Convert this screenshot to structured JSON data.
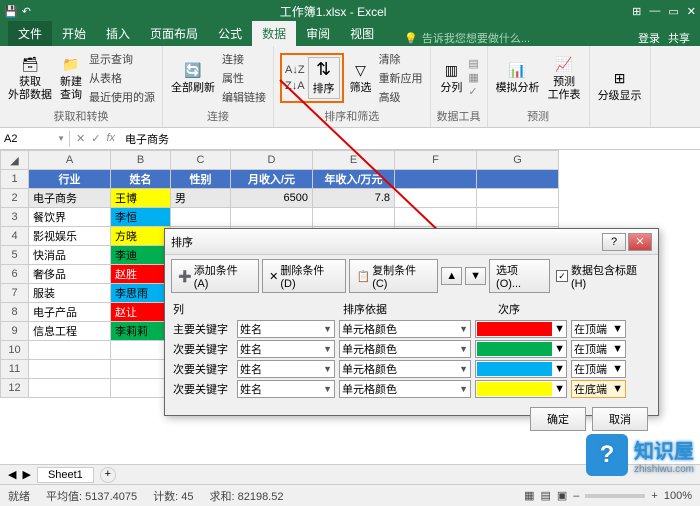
{
  "title": "工作簿1.xlsx - Excel",
  "tabs": {
    "file": "文件",
    "home": "开始",
    "insert": "插入",
    "layout": "页面布局",
    "formula": "公式",
    "data": "数据",
    "review": "审阅",
    "view": "视图",
    "tell": "告诉我您想要做什么...",
    "login": "登录",
    "share": "共享"
  },
  "ribbon": {
    "g1": {
      "btn1": "获取\n外部数据",
      "btn2": "新建\n查询",
      "s1": "显示查询",
      "s2": "从表格",
      "s3": "最近使用的源",
      "label": "获取和转换"
    },
    "g2": {
      "btn": "全部刷新",
      "s1": "连接",
      "s2": "属性",
      "s3": "编辑链接",
      "label": "连接"
    },
    "g3": {
      "az": "A↓Z",
      "za": "Z↓A",
      "sort": "排序",
      "filter": "筛选",
      "clear": "清除",
      "reapply": "重新应用",
      "adv": "高级",
      "label": "排序和筛选"
    },
    "g4": {
      "btn": "分列",
      "label": "数据工具"
    },
    "g5": {
      "b1": "模拟分析",
      "b2": "预测\n工作表",
      "label": "预测"
    },
    "g6": {
      "btn": "分级显示",
      "label": ""
    }
  },
  "namebox": "A2",
  "formula": "电子商务",
  "cols": [
    "A",
    "B",
    "C",
    "D",
    "E",
    "F",
    "G"
  ],
  "headers": [
    "行业",
    "姓名",
    "性别",
    "月收入/元",
    "年收入/万元"
  ],
  "rows": [
    {
      "r": 2,
      "a": "电子商务",
      "b": "王博",
      "bcolor": "#ffff00",
      "c": "男",
      "d": "6500",
      "e": "7.8",
      "sel": true
    },
    {
      "r": 3,
      "a": "餐饮界",
      "b": "李恒",
      "bcolor": "#00b0f0"
    },
    {
      "r": 4,
      "a": "影视娱乐",
      "b": "方晓",
      "bcolor": "#ffff00"
    },
    {
      "r": 5,
      "a": "快消品",
      "b": "李迪",
      "bcolor": "#00b050"
    },
    {
      "r": 6,
      "a": "奢侈品",
      "b": "赵胜",
      "bcolor": "#ff0000",
      "fg": "#fff"
    },
    {
      "r": 7,
      "a": "服装",
      "b": "李思雨",
      "bcolor": "#00b0f0"
    },
    {
      "r": 8,
      "a": "电子产品",
      "b": "赵让",
      "bcolor": "#ff0000",
      "fg": "#fff"
    },
    {
      "r": 9,
      "a": "信息工程",
      "b": "李莉莉",
      "bcolor": "#00b050"
    }
  ],
  "dialog": {
    "title": "排序",
    "addCond": "添加条件(A)",
    "delCond": "删除条件(D)",
    "copyCond": "复制条件(C)",
    "options": "选项(O)...",
    "hasHeader": "数据包含标题(H)",
    "colHead": "列",
    "sortByHead": "排序依据",
    "orderHead": "次序",
    "mainKey": "主要关键字",
    "subKey": "次要关键字",
    "field": "姓名",
    "basis": "单元格颜色",
    "posTop": "在顶端",
    "posBottom": "在底端",
    "colors": [
      "#ff0000",
      "#00b050",
      "#00b0f0",
      "#ffff00"
    ],
    "ok": "确定",
    "cancel": "取消"
  },
  "bottom": {
    "sheet": "Sheet1",
    "plus": "+"
  },
  "status": {
    "ready": "就绪",
    "avg": "平均值: 5137.4075",
    "count": "计数: 45",
    "sum": "求和: 82198.52",
    "zoom": "100%"
  },
  "watermark": {
    "name": "知识屋",
    "url": "zhishiwu.com"
  }
}
